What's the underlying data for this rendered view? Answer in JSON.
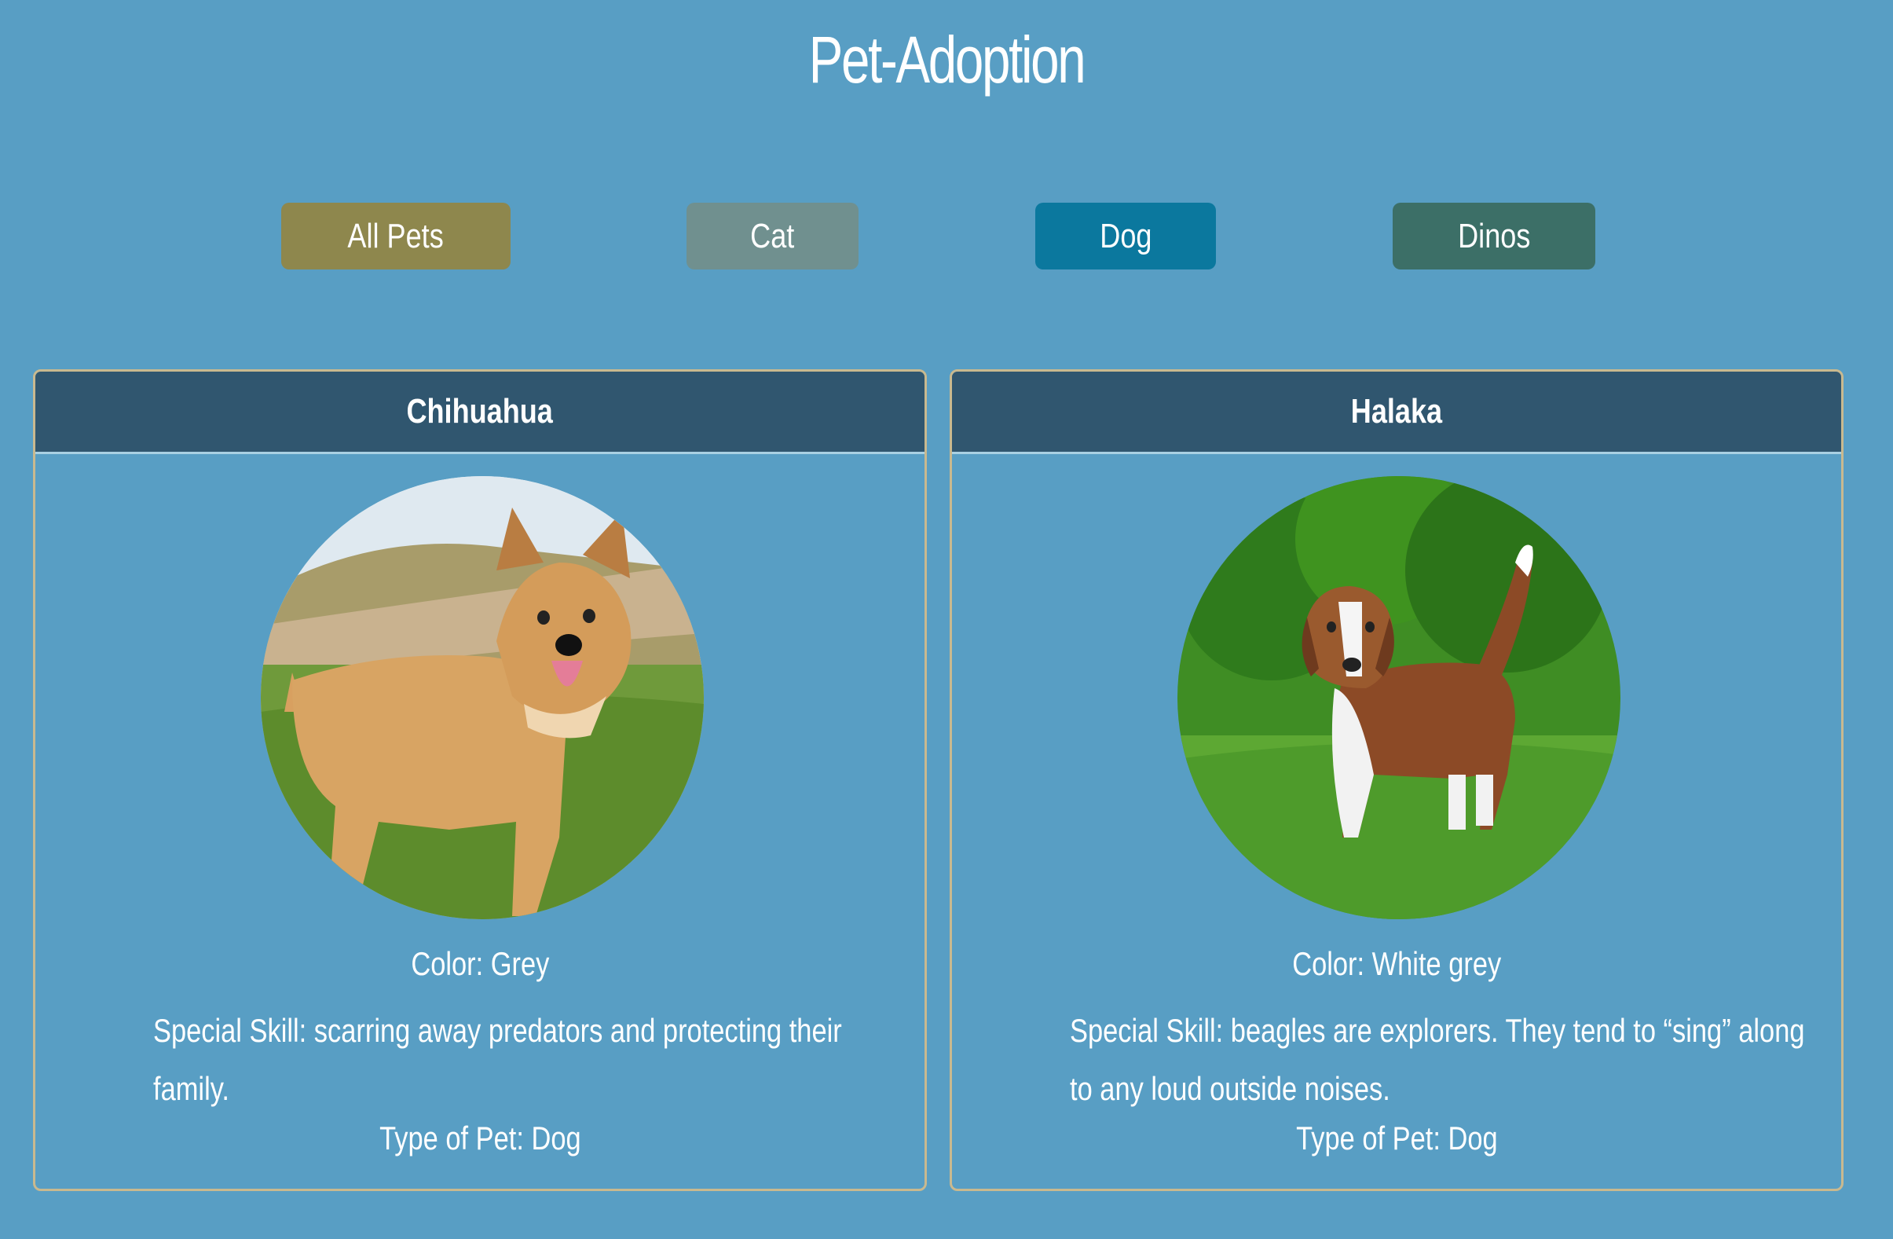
{
  "header": {
    "title": "Pet-Adoption"
  },
  "filters": [
    {
      "label": "All Pets"
    },
    {
      "label": "Cat"
    },
    {
      "label": "Dog"
    },
    {
      "label": "Dinos"
    }
  ],
  "pets": [
    {
      "name": "Chihuahua",
      "image": "tan-dog-photo",
      "color": "Color: Grey",
      "skill": "Special Skill: scarring away predators and protecting their family.",
      "type": "Type of Pet: Dog"
    },
    {
      "name": "Halaka",
      "image": "beagle-photo",
      "color": "Color: White grey",
      "skill": "Special Skill: beagles are explorers. They tend to “sing” along to any loud outside noises.",
      "type": "Type of Pet: Dog"
    }
  ],
  "colors": {
    "background": "#589ec4",
    "card_header": "#30566f",
    "all_pets_button": "#8e874d",
    "cat_button": "#70908f",
    "dog_button": "#0b789e",
    "dinos_button": "#3c6f67",
    "card_border": "#c9b98f"
  }
}
